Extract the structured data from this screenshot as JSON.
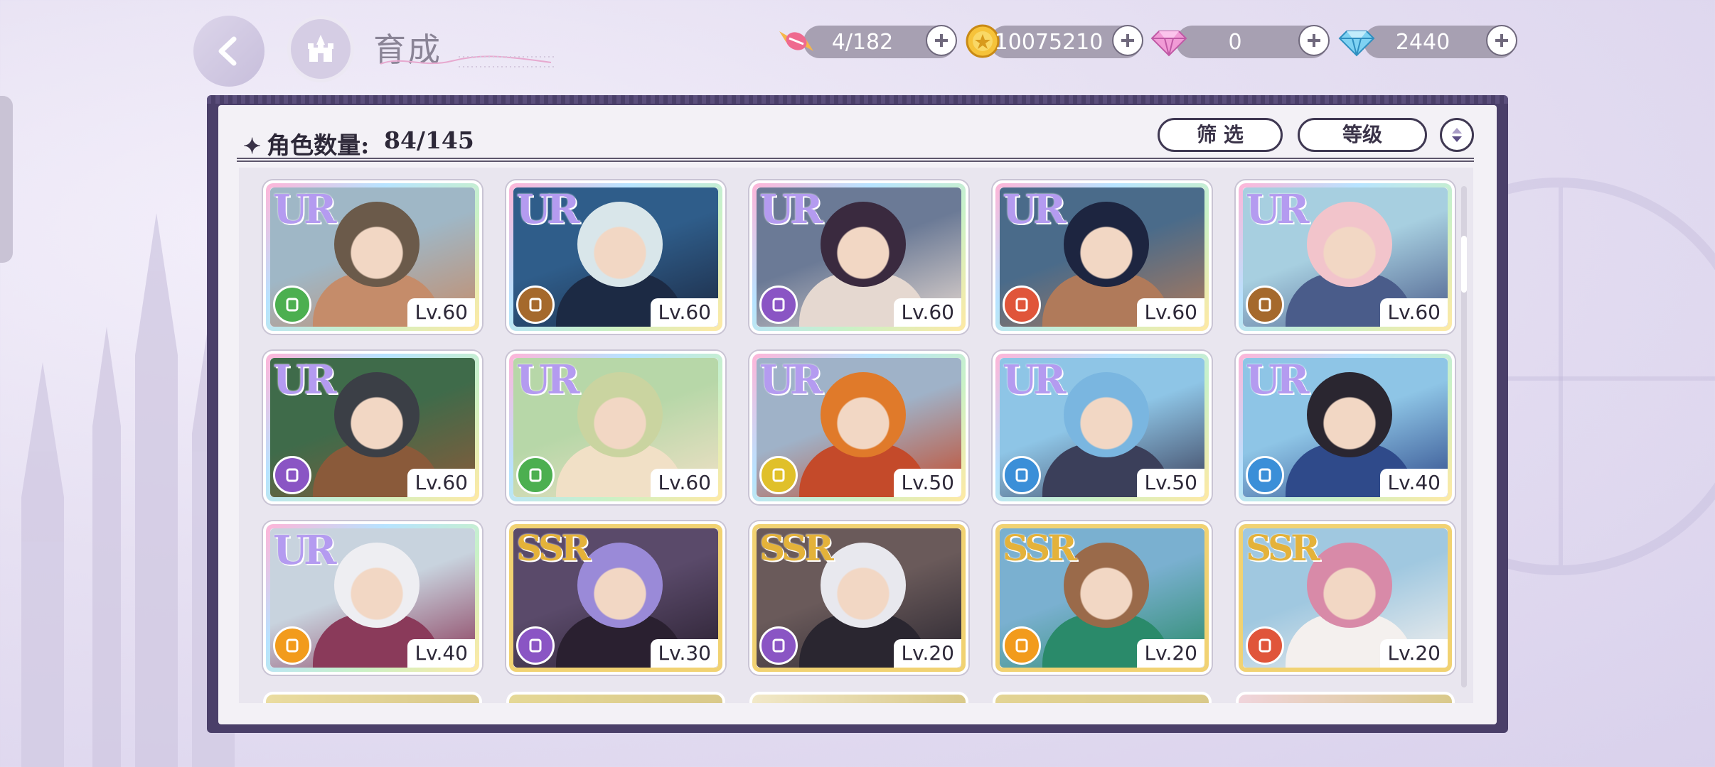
{
  "header": {
    "title": "育成",
    "title_script": "Growth"
  },
  "resources": [
    {
      "name": "candy",
      "value": "4/182"
    },
    {
      "name": "coin",
      "value": "10075210"
    },
    {
      "name": "pink-gem",
      "value": "0"
    },
    {
      "name": "blue-gem",
      "value": "2440"
    }
  ],
  "panel": {
    "count_label": "角色数量:",
    "count_value": "84/145",
    "filter_label": "筛 选",
    "sort_label": "等级"
  },
  "colors": {
    "green": "#4caf50",
    "brown": "#a5692c",
    "purple": "#8a55c4",
    "red": "#e0553a",
    "yellow": "#e0c02a",
    "blue": "#3b8fd8",
    "orange": "#f29b1c"
  },
  "cards": [
    {
      "rarity": "UR",
      "level": "Lv.60",
      "class_color": "green",
      "class_icon": "fist-icon"
    },
    {
      "rarity": "UR",
      "level": "Lv.60",
      "class_color": "brown",
      "class_icon": "boot-icon"
    },
    {
      "rarity": "UR",
      "level": "Lv.60",
      "class_color": "purple",
      "class_icon": "fist-icon"
    },
    {
      "rarity": "UR",
      "level": "Lv.60",
      "class_color": "red",
      "class_icon": "fist-icon"
    },
    {
      "rarity": "UR",
      "level": "Lv.60",
      "class_color": "brown",
      "class_icon": "wand-icon"
    },
    {
      "rarity": "UR",
      "level": "Lv.60",
      "class_color": "purple",
      "class_icon": "hat-icon"
    },
    {
      "rarity": "UR",
      "level": "Lv.60",
      "class_color": "green",
      "class_icon": "boot-icon"
    },
    {
      "rarity": "UR",
      "level": "Lv.50",
      "class_color": "yellow",
      "class_icon": "shield-icon"
    },
    {
      "rarity": "UR",
      "level": "Lv.50",
      "class_color": "blue",
      "class_icon": "wand-icon"
    },
    {
      "rarity": "UR",
      "level": "Lv.40",
      "class_color": "blue",
      "class_icon": "shield-icon"
    },
    {
      "rarity": "UR",
      "level": "Lv.40",
      "class_color": "orange",
      "class_icon": "fist-icon"
    },
    {
      "rarity": "SSR",
      "level": "Lv.30",
      "class_color": "purple",
      "class_icon": "fist-icon"
    },
    {
      "rarity": "SSR",
      "level": "Lv.20",
      "class_color": "purple",
      "class_icon": "boot-icon"
    },
    {
      "rarity": "SSR",
      "level": "Lv.20",
      "class_color": "orange",
      "class_icon": "card-icon"
    },
    {
      "rarity": "SSR",
      "level": "Lv.20",
      "class_color": "red",
      "class_icon": "boot-icon"
    }
  ]
}
